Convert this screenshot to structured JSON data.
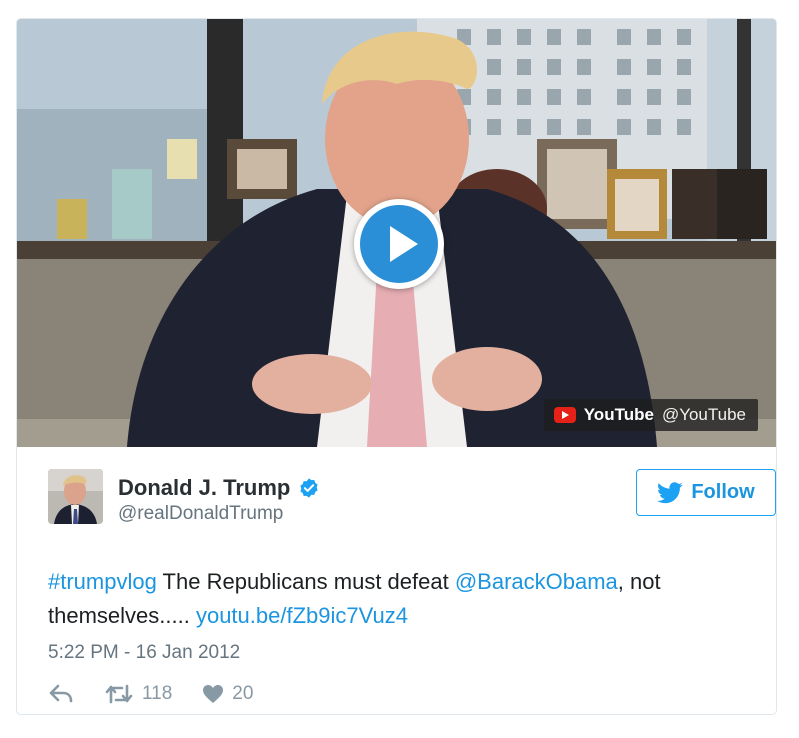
{
  "video": {
    "source_name": "YouTube",
    "source_handle": "@YouTube",
    "play_icon": "play-icon"
  },
  "author": {
    "display_name": "Donald J. Trump",
    "handle": "@realDonaldTrump",
    "verified_icon": "verified-badge-icon"
  },
  "follow": {
    "label": "Follow",
    "icon": "twitter-bird-icon"
  },
  "tweet": {
    "hashtag": "#trumpvlog",
    "text_1": " The Republicans must defeat ",
    "mention": "@BarackObama",
    "text_2": ", not themselves..... ",
    "link": "youtu.be/fZb9ic7Vuz4",
    "timestamp": "5:22 PM - 16 Jan 2012"
  },
  "stats": {
    "retweets": "118",
    "likes": "20"
  },
  "colors": {
    "link_blue": "#1b95e0",
    "play_blue": "#2b8fd8",
    "youtube_red": "#e62117",
    "muted_gray": "#66757f"
  }
}
